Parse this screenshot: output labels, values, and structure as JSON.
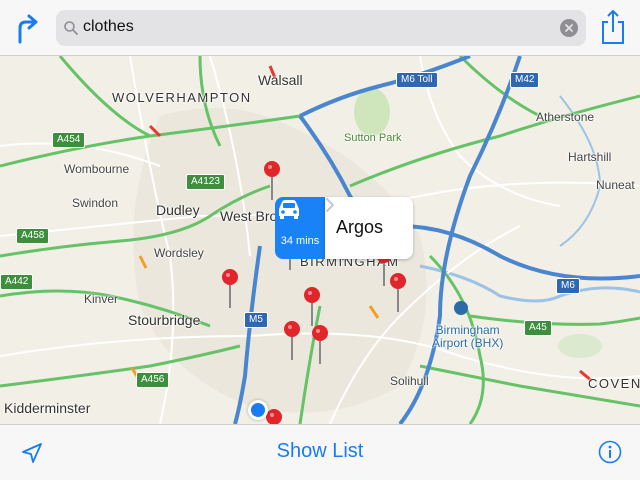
{
  "search": {
    "query": "clothes"
  },
  "callout": {
    "eta": "34 mins",
    "title": "Argos"
  },
  "bottom_bar": {
    "show_list_label": "Show List"
  },
  "places": {
    "wolverhampton": "WOLVERHAMPTON",
    "walsall": "Walsall",
    "sutton_park": "Sutton Park",
    "atherstone": "Atherstone",
    "hartshill": "Hartshill",
    "nuneaton": "Nuneat",
    "wombourne": "Wombourne",
    "swindon": "Swindon",
    "dudley": "Dudley",
    "west_bromwich": "West Bromwich",
    "wordsley": "Wordsley",
    "birmingham": "BIRMINGHAM",
    "kinver": "Kinver",
    "stourbridge": "Stourbridge",
    "birmingham_airport": "Birmingham\nAirport (BHX)",
    "solihull": "Solihull",
    "kidderminster": "Kidderminster",
    "coventry": "COVENT"
  },
  "road_shields": {
    "m6_toll": "M6 Toll",
    "m42_top": "M42",
    "a454": "A454",
    "a4123": "A4123",
    "m6_mid": "M6",
    "m6_east": "M6",
    "a458": "A458",
    "a442": "A442",
    "m5": "M5",
    "a45": "A45",
    "a456": "A456"
  },
  "colors": {
    "accent": "#1a7cf0",
    "callout_blue": "#1a82f7",
    "pin_red": "#e0262b",
    "a_road": "#3d8e3d",
    "motorway": "#2f67b2"
  }
}
